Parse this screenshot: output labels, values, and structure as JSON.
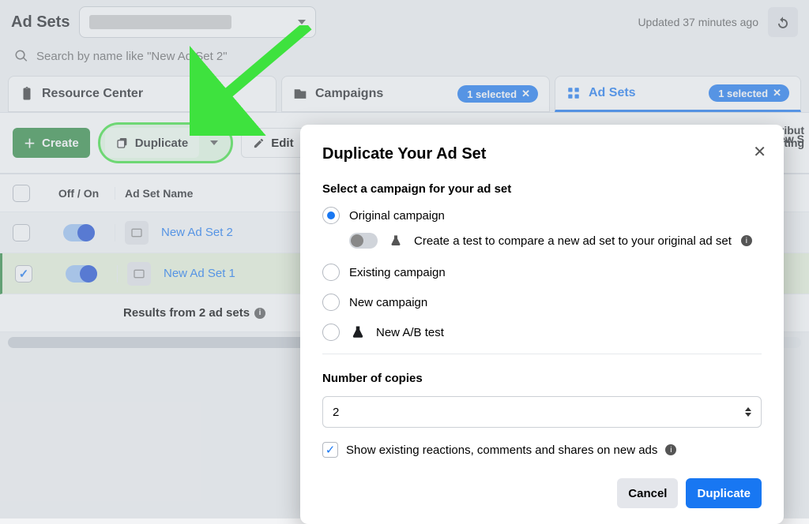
{
  "header": {
    "title": "Ad Sets",
    "updated": "Updated 37 minutes ago"
  },
  "search": {
    "placeholder": "Search by name like \"New Ad Set 2\""
  },
  "tabs": {
    "resource": "Resource Center",
    "campaigns": "Campaigns",
    "adsets": "Ad Sets",
    "chip": "1 selected"
  },
  "toolbar": {
    "create": "Create",
    "duplicate": "Duplicate",
    "edit": "Edit"
  },
  "table": {
    "col_toggle": "Off / On",
    "col_name": "Ad Set Name",
    "col_view": "View S",
    "col_attr1": "tribut",
    "col_attr2": "ting",
    "rows": [
      {
        "name": "New Ad Set 2",
        "checked": false
      },
      {
        "name": "New Ad Set 1",
        "checked": true
      }
    ],
    "summary": "Results from 2 ad sets"
  },
  "modal": {
    "title": "Duplicate Your Ad Set",
    "section": "Select a campaign for your ad set",
    "opt_original": "Original campaign",
    "opt_test": "Create a test to compare a new ad set to your original ad set",
    "opt_existing": "Existing campaign",
    "opt_new": "New campaign",
    "opt_ab": "New A/B test",
    "copies_label": "Number of copies",
    "copies_value": "2",
    "show_existing": "Show existing reactions, comments and shares on new ads",
    "cancel": "Cancel",
    "duplicate": "Duplicate"
  }
}
